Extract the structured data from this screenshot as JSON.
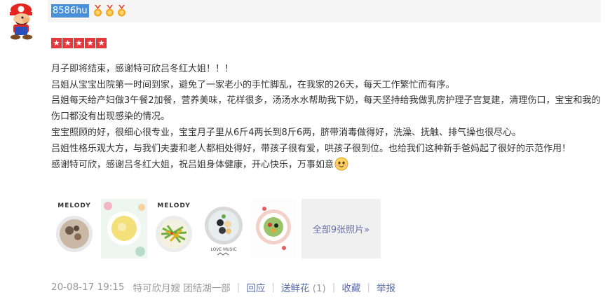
{
  "user": {
    "name": "8586hu",
    "medal_count": 3
  },
  "rating": {
    "stars": 5,
    "star_glyph": "★"
  },
  "review": {
    "paragraphs": [
      "月子即将结束，感谢特可欣吕冬红大姐！！！",
      "吕姐从宝宝出院第一时间到家，避免了一家老小的手忙脚乱，在我家的26天，每天工作繁忙而有序。",
      "吕姐每天给产妇做3午餐2加餐，营养美味，花样很多，汤汤水水帮助我下奶，每天坚持给我做乳房护理子宫复建，清理伤口，宝宝和我的伤口都没有出现感染的情况。",
      "宝宝照顾的好，很细心很专业，宝宝月子里从6斤4两长到8斤6两，脐带消毒做得好，洗澡、抚触、排气操也很尽心。",
      "吕姐性格乐观大方，与我们夫妻和老人都相处得好，带孩子很有爱，哄孩子很到位。也给我们这种新手爸妈起了很好的示范作用！",
      "感谢特可欣，感谢吕冬红大姐，祝吕姐身体健康，开心快乐，万事如意"
    ],
    "emoji": "smile-emoji"
  },
  "photos": {
    "items": [
      {
        "label": "MELODY"
      },
      {
        "label": ""
      },
      {
        "label": "MELODY"
      },
      {
        "label": "LOVE MUSIC"
      },
      {
        "label": ""
      }
    ],
    "more_label": "全部9张照片»"
  },
  "footer": {
    "timestamp": "20-08-17 19:15",
    "author": "特可欣月嫂 团结湖一部",
    "reply": "回应",
    "flowers": "送鲜花",
    "flowers_count": "(1)",
    "favorite": "收藏",
    "report": "举报"
  },
  "colors": {
    "accent_red": "#e4393c",
    "link_blue": "#5a6ea8",
    "username_bg": "#4a90d9",
    "meta_gray": "#999999"
  }
}
